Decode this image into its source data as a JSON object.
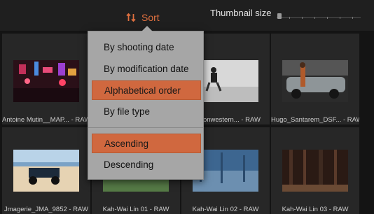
{
  "toolbar": {
    "sort_label": "Sort",
    "sort_icon": "sort-arrows-icon",
    "thumbnail_size_label": "Thumbnail size",
    "thumbnail_size_value": 0.05
  },
  "sort_menu": {
    "items": [
      {
        "label": "By shooting date",
        "selected": false
      },
      {
        "label": "By modification date",
        "selected": false
      },
      {
        "label": "Alphabetical order",
        "selected": true
      },
      {
        "label": "By file type",
        "selected": false
      }
    ],
    "order_items": [
      {
        "label": "Ascending",
        "selected": true
      },
      {
        "label": "Descending",
        "selected": false
      }
    ]
  },
  "thumbnails": [
    {
      "caption": "Antoine Mutin__MAP... - RAW"
    },
    {
      "caption": ""
    },
    {
      "caption": "Wilsonwestern... - RAW"
    },
    {
      "caption": "Hugo_Santarem_DSF... - RAW"
    },
    {
      "caption": "Jmagerie_JMA_9852 - RAW"
    },
    {
      "caption": "Kah-Wai Lin 01 - RAW"
    },
    {
      "caption": "Kah-Wai Lin 02 - RAW"
    },
    {
      "caption": "Kah-Wai Lin 03 - RAW"
    }
  ],
  "colors": {
    "accent": "#e0703f",
    "menu_background": "#a6a6a6",
    "menu_highlight": "#d0683f"
  }
}
